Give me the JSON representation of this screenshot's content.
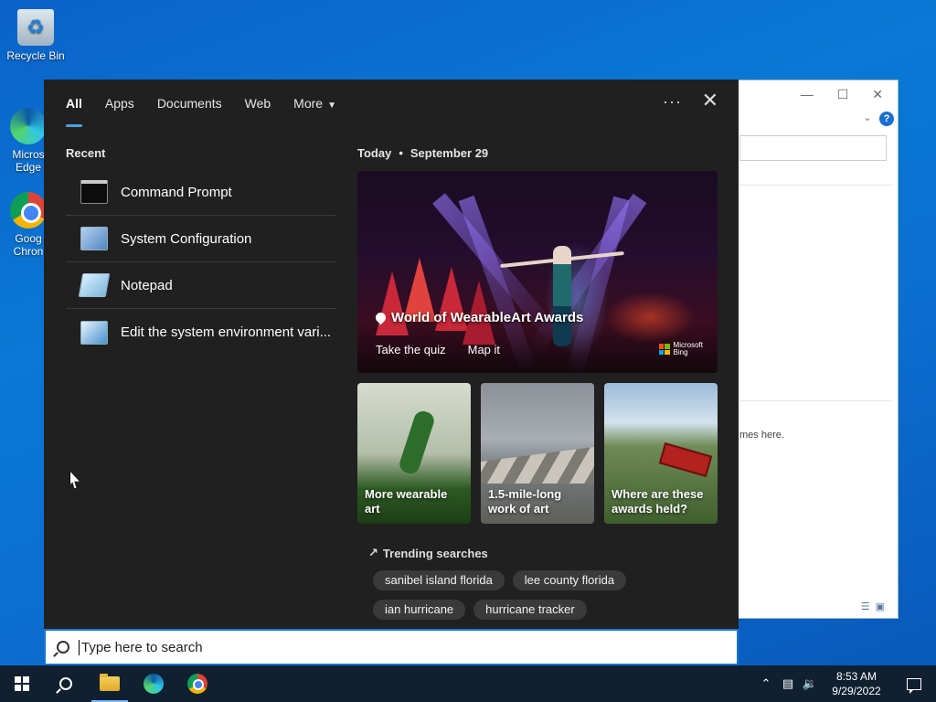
{
  "desktop": {
    "icons": [
      {
        "label": "Recycle Bin"
      },
      {
        "label": "Micros Edge"
      },
      {
        "label": "Goog Chron"
      }
    ]
  },
  "background_window": {
    "partial_text": "mes here."
  },
  "search_panel": {
    "tabs": [
      {
        "label": "All",
        "active": true
      },
      {
        "label": "Apps"
      },
      {
        "label": "Documents"
      },
      {
        "label": "Web"
      },
      {
        "label": "More"
      }
    ],
    "more_options_label": "···",
    "close_label": "✕",
    "recent": {
      "title": "Recent",
      "items": [
        {
          "label": "Command Prompt",
          "icon": "command-prompt-icon"
        },
        {
          "label": "System Configuration",
          "icon": "system-configuration-icon"
        },
        {
          "label": "Notepad",
          "icon": "notepad-icon"
        },
        {
          "label": "Edit the system environment vari...",
          "icon": "environment-variables-icon"
        }
      ]
    },
    "today": {
      "label": "Today",
      "date": "September 29"
    },
    "hero": {
      "title": "World of WearableArt Awards",
      "links": [
        "Take the quiz",
        "Map it"
      ],
      "brand_line1": "Microsoft",
      "brand_line2": "Bing"
    },
    "tiles": [
      {
        "label": "More wearable art"
      },
      {
        "label": "1.5-mile-long work of art"
      },
      {
        "label": "Where are these awards held?"
      }
    ],
    "trending": {
      "title": "Trending searches",
      "items": [
        "sanibel island florida",
        "lee county florida",
        "ian hurricane",
        "hurricane tracker"
      ]
    }
  },
  "search_box": {
    "placeholder": "Type here to search"
  },
  "taskbar": {
    "apps": [
      {
        "name": "start-button"
      },
      {
        "name": "search-button"
      },
      {
        "name": "file-explorer"
      },
      {
        "name": "microsoft-edge"
      },
      {
        "name": "google-chrome"
      }
    ],
    "clock_time": "8:53 AM",
    "clock_date": "9/29/2022"
  },
  "colors": {
    "accent": "#4c9fe8",
    "panel_bg": "#202020",
    "taskbar_bg": "#102030",
    "desktop_blue": "#0a78d4"
  }
}
